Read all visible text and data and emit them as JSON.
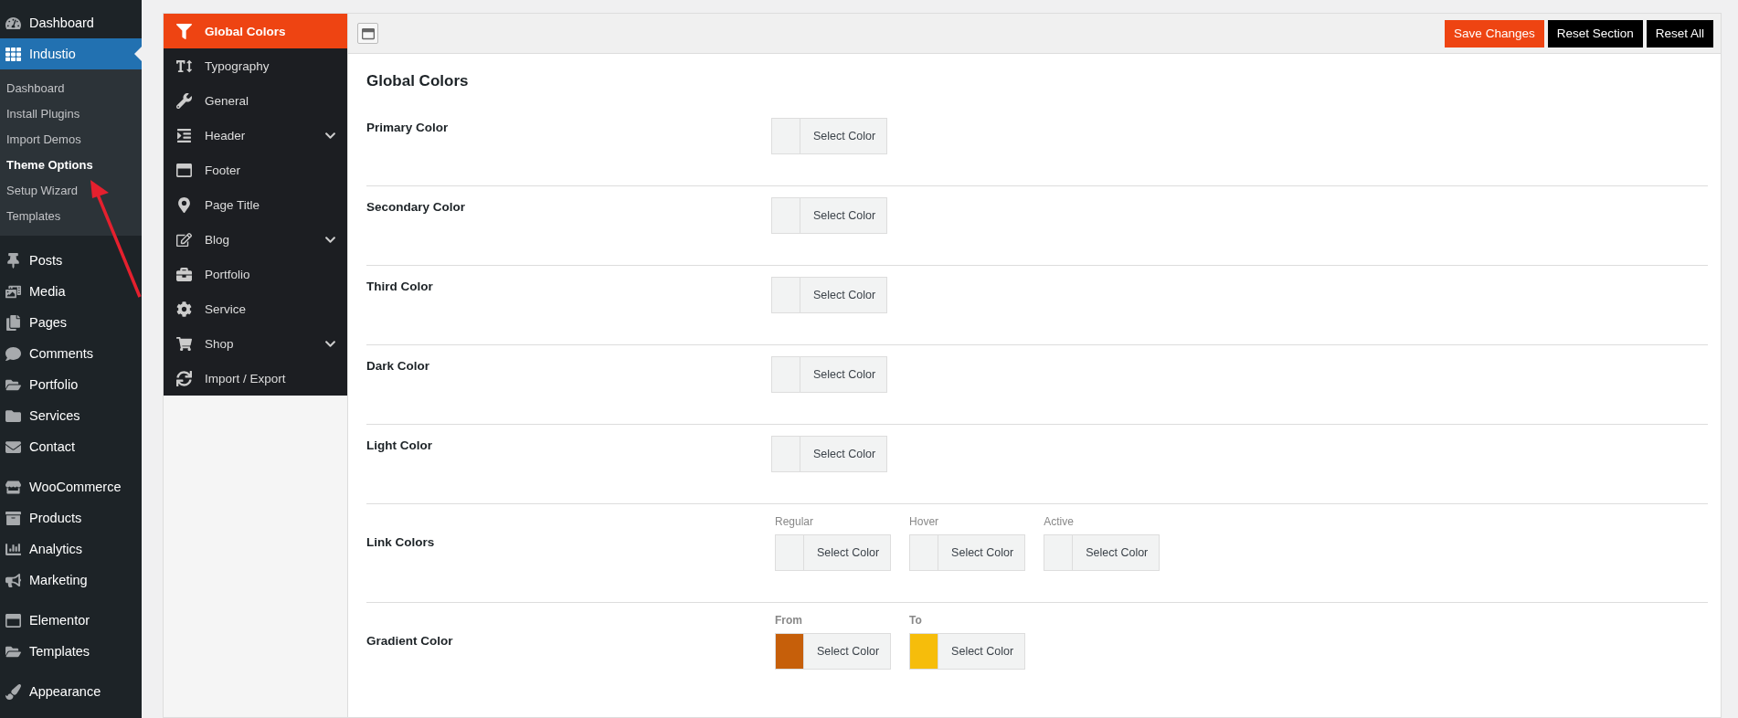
{
  "admin_menu": [
    {
      "label": "Dashboard",
      "selected": false
    },
    {
      "label": "Industio",
      "selected": true,
      "submenu": [
        {
          "label": "Dashboard",
          "selected": false
        },
        {
          "label": "Install Plugins",
          "selected": false
        },
        {
          "label": "Import Demos",
          "selected": false
        },
        {
          "label": "Theme Options",
          "selected": true
        },
        {
          "label": "Setup Wizard",
          "selected": false
        },
        {
          "label": "Templates",
          "selected": false
        }
      ]
    },
    {
      "label": "Posts",
      "selected": false
    },
    {
      "label": "Media",
      "selected": false
    },
    {
      "label": "Pages",
      "selected": false
    },
    {
      "label": "Comments",
      "selected": false
    },
    {
      "label": "Portfolio",
      "selected": false
    },
    {
      "label": "Services",
      "selected": false
    },
    {
      "label": "Contact",
      "selected": false
    },
    {
      "label": "WooCommerce",
      "selected": false
    },
    {
      "label": "Products",
      "selected": false
    },
    {
      "label": "Analytics",
      "selected": false
    },
    {
      "label": "Marketing",
      "selected": false
    },
    {
      "label": "Elementor",
      "selected": false
    },
    {
      "label": "Templates",
      "selected": false
    },
    {
      "label": "Appearance",
      "selected": false
    }
  ],
  "options_nav": [
    {
      "label": "Global Colors",
      "selected": true,
      "expandable": false
    },
    {
      "label": "Typography",
      "selected": false,
      "expandable": false
    },
    {
      "label": "General",
      "selected": false,
      "expandable": false
    },
    {
      "label": "Header",
      "selected": false,
      "expandable": true
    },
    {
      "label": "Footer",
      "selected": false,
      "expandable": false
    },
    {
      "label": "Page Title",
      "selected": false,
      "expandable": false
    },
    {
      "label": "Blog",
      "selected": false,
      "expandable": true
    },
    {
      "label": "Portfolio",
      "selected": false,
      "expandable": false
    },
    {
      "label": "Service",
      "selected": false,
      "expandable": false
    },
    {
      "label": "Shop",
      "selected": false,
      "expandable": true
    },
    {
      "label": "Import / Export",
      "selected": false,
      "expandable": false
    }
  ],
  "toolbar_buttons": [
    {
      "label": "Save Changes",
      "kind": "primary"
    },
    {
      "label": "Reset Section",
      "kind": "dark"
    },
    {
      "label": "Reset All",
      "kind": "dark"
    }
  ],
  "section_title": "Global Colors",
  "fields": [
    {
      "label": "Primary Color",
      "pickers": [
        {
          "button": "Select Color"
        }
      ]
    },
    {
      "label": "Secondary Color",
      "pickers": [
        {
          "button": "Select Color"
        }
      ]
    },
    {
      "label": "Third Color",
      "pickers": [
        {
          "button": "Select Color"
        }
      ]
    },
    {
      "label": "Dark Color",
      "pickers": [
        {
          "button": "Select Color"
        }
      ]
    },
    {
      "label": "Light Color",
      "pickers": [
        {
          "button": "Select Color"
        }
      ]
    },
    {
      "label": "Link Colors",
      "pickers": [
        {
          "caption": "Regular",
          "caption_bold": false,
          "button": "Select Color"
        },
        {
          "caption": "Hover",
          "caption_bold": false,
          "button": "Select Color"
        },
        {
          "caption": "Active",
          "caption_bold": false,
          "button": "Select Color"
        }
      ]
    },
    {
      "label": "Gradient Color",
      "pickers": [
        {
          "caption": "From",
          "caption_bold": true,
          "button": "Select Color",
          "color": "#c65f0a"
        },
        {
          "caption": "To",
          "caption_bold": true,
          "button": "Select Color",
          "color": "#f6bd0b"
        }
      ]
    }
  ]
}
